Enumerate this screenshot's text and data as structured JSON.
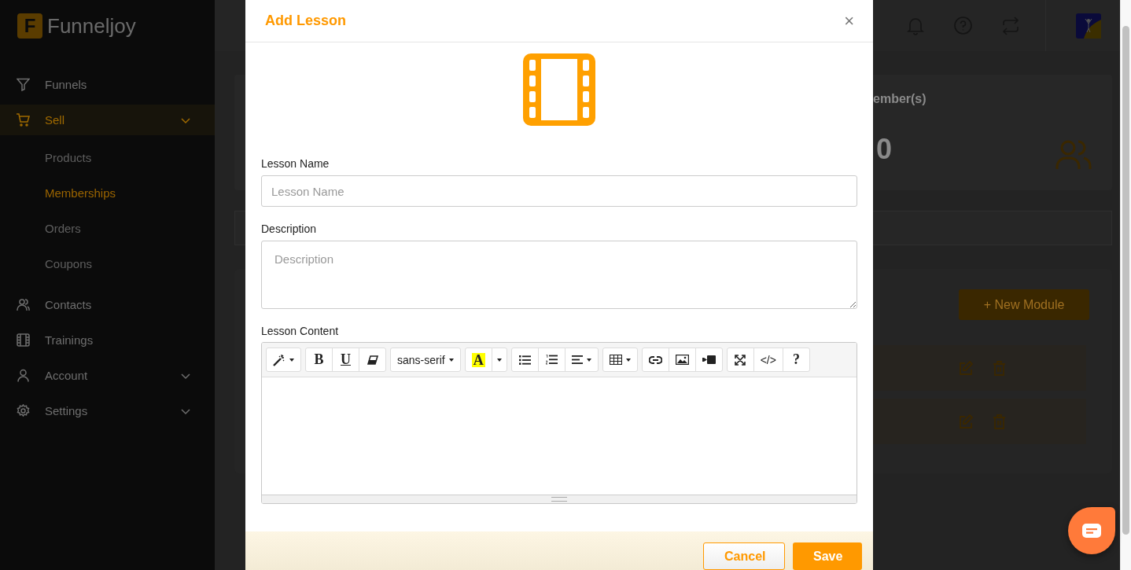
{
  "sidebar": {
    "logo": {
      "letter": "F",
      "name": "Funneljoy"
    },
    "items": [
      {
        "label": "Funnels",
        "selected": false,
        "kind": "link"
      },
      {
        "label": "Sell",
        "selected": true,
        "kind": "group",
        "children": [
          {
            "label": "Products",
            "selected": false
          },
          {
            "label": "Memberships",
            "selected": true
          },
          {
            "label": "Orders",
            "selected": false
          },
          {
            "label": "Coupons",
            "selected": false
          }
        ]
      },
      {
        "label": "Contacts",
        "selected": false,
        "kind": "link"
      },
      {
        "label": "Trainings",
        "selected": false,
        "kind": "link"
      },
      {
        "label": "Account",
        "selected": false,
        "kind": "group"
      },
      {
        "label": "Settings",
        "selected": false,
        "kind": "group"
      }
    ]
  },
  "stats_card": {
    "label": "ember(s)",
    "value": "0"
  },
  "modules": {
    "new_button": "+ New Module",
    "rows": [
      {
        "kind": "module"
      },
      {
        "kind": "module"
      }
    ]
  },
  "modal": {
    "title": "Add Lesson",
    "close": "×",
    "fields": [
      {
        "label": "Lesson Name",
        "kind": "input",
        "placeholder": "Lesson Name"
      },
      {
        "label": "Description",
        "kind": "textarea",
        "placeholder": "Description"
      }
    ],
    "editor": {
      "label": "Lesson Content",
      "toolbar": [
        [
          {
            "kind": "icon-dropdown"
          }
        ],
        [
          {
            "kind": "text",
            "label": "B"
          },
          {
            "kind": "text",
            "label": "U"
          },
          {
            "kind": "icon"
          }
        ],
        [
          {
            "kind": "text-dropdown",
            "label": "sans-serif"
          }
        ],
        [
          {
            "kind": "highlight",
            "label": "A"
          },
          {
            "kind": "caret"
          }
        ],
        [
          {
            "kind": "icon"
          },
          {
            "kind": "icon"
          },
          {
            "kind": "icon-dropdown"
          }
        ],
        [
          {
            "kind": "icon-dropdown"
          }
        ],
        [
          {
            "kind": "icon"
          },
          {
            "kind": "icon"
          },
          {
            "kind": "icon"
          }
        ],
        [
          {
            "kind": "icon"
          },
          {
            "kind": "text",
            "label": "</>"
          },
          {
            "kind": "text",
            "label": "?"
          }
        ]
      ]
    },
    "buttons": [
      {
        "label": "Cancel",
        "kind": "secondary"
      },
      {
        "label": "Save",
        "kind": "primary"
      }
    ]
  }
}
